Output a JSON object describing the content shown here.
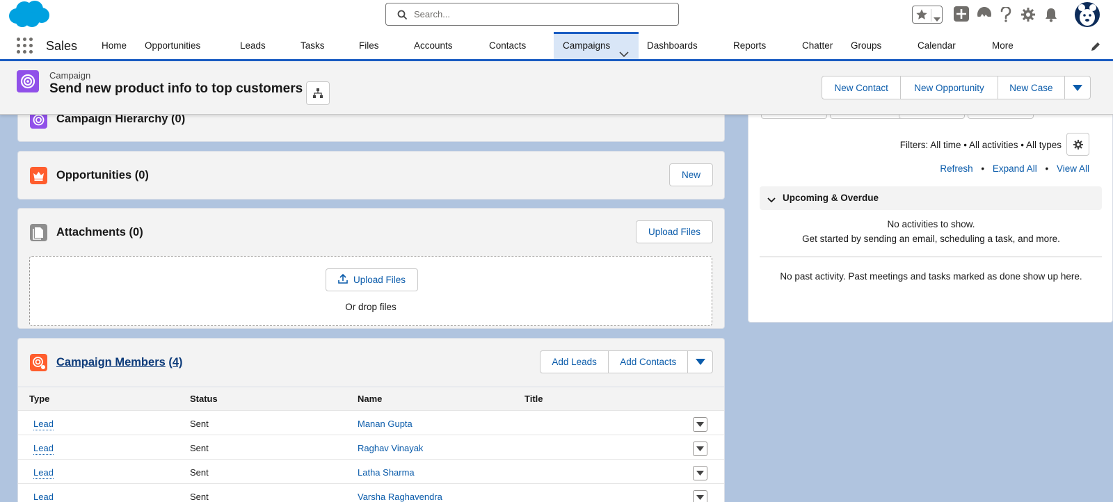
{
  "global_header": {
    "search_placeholder": "Search..."
  },
  "nav": {
    "app_name": "Sales",
    "items": [
      {
        "label": "Home"
      },
      {
        "label": "Opportunities"
      },
      {
        "label": "Leads"
      },
      {
        "label": "Tasks"
      },
      {
        "label": "Files"
      },
      {
        "label": "Accounts"
      },
      {
        "label": "Contacts"
      },
      {
        "label": "Campaigns",
        "active": true
      },
      {
        "label": "Dashboards"
      },
      {
        "label": "Reports"
      },
      {
        "label": "Chatter"
      },
      {
        "label": "Groups"
      },
      {
        "label": "Calendar"
      },
      {
        "label": "More"
      }
    ]
  },
  "record": {
    "type": "Campaign",
    "title": "Send new product info to top customers",
    "actions": [
      "New Contact",
      "New Opportunity",
      "New Case"
    ]
  },
  "cards": {
    "hierarchy": {
      "title": "Campaign Hierarchy (0)"
    },
    "opportunities": {
      "title": "Opportunities (0)",
      "new_button": "New"
    },
    "attachments": {
      "title": "Attachments (0)",
      "upload_button": "Upload Files",
      "drop_upload_button": "Upload Files",
      "drop_text": "Or drop files"
    },
    "members": {
      "title": "Campaign Members",
      "count": "(4)",
      "add_leads": "Add Leads",
      "add_contacts": "Add Contacts",
      "columns": [
        "Type",
        "Status",
        "Name",
        "Title"
      ],
      "rows": [
        {
          "type": "Lead",
          "status": "Sent",
          "name": "Manan Gupta",
          "title": ""
        },
        {
          "type": "Lead",
          "status": "Sent",
          "name": "Raghav Vinayak",
          "title": ""
        },
        {
          "type": "Lead",
          "status": "Sent",
          "name": "Latha Sharma",
          "title": ""
        },
        {
          "type": "Lead",
          "status": "Sent",
          "name": "Varsha Raghavendra",
          "title": ""
        }
      ]
    }
  },
  "activity": {
    "filters": "Filters: All time • All activities • All types",
    "links": {
      "refresh": "Refresh",
      "expand_all": "Expand All",
      "view_all": "View All"
    },
    "separator": "•",
    "upcoming_title": "Upcoming & Overdue",
    "no_activities": "No activities to show.",
    "get_started": "Get started by sending an email, scheduling a task, and more.",
    "no_past": "No past activity. Past meetings and tasks marked as done show up here."
  },
  "colors": {
    "brand_blue": "#0b5cab",
    "nav_active_bg": "#d9e6f7",
    "campaign_purple": "#9050e9",
    "opportunity_orange": "#ff5d2d",
    "page_bg": "#b0c4df"
  }
}
